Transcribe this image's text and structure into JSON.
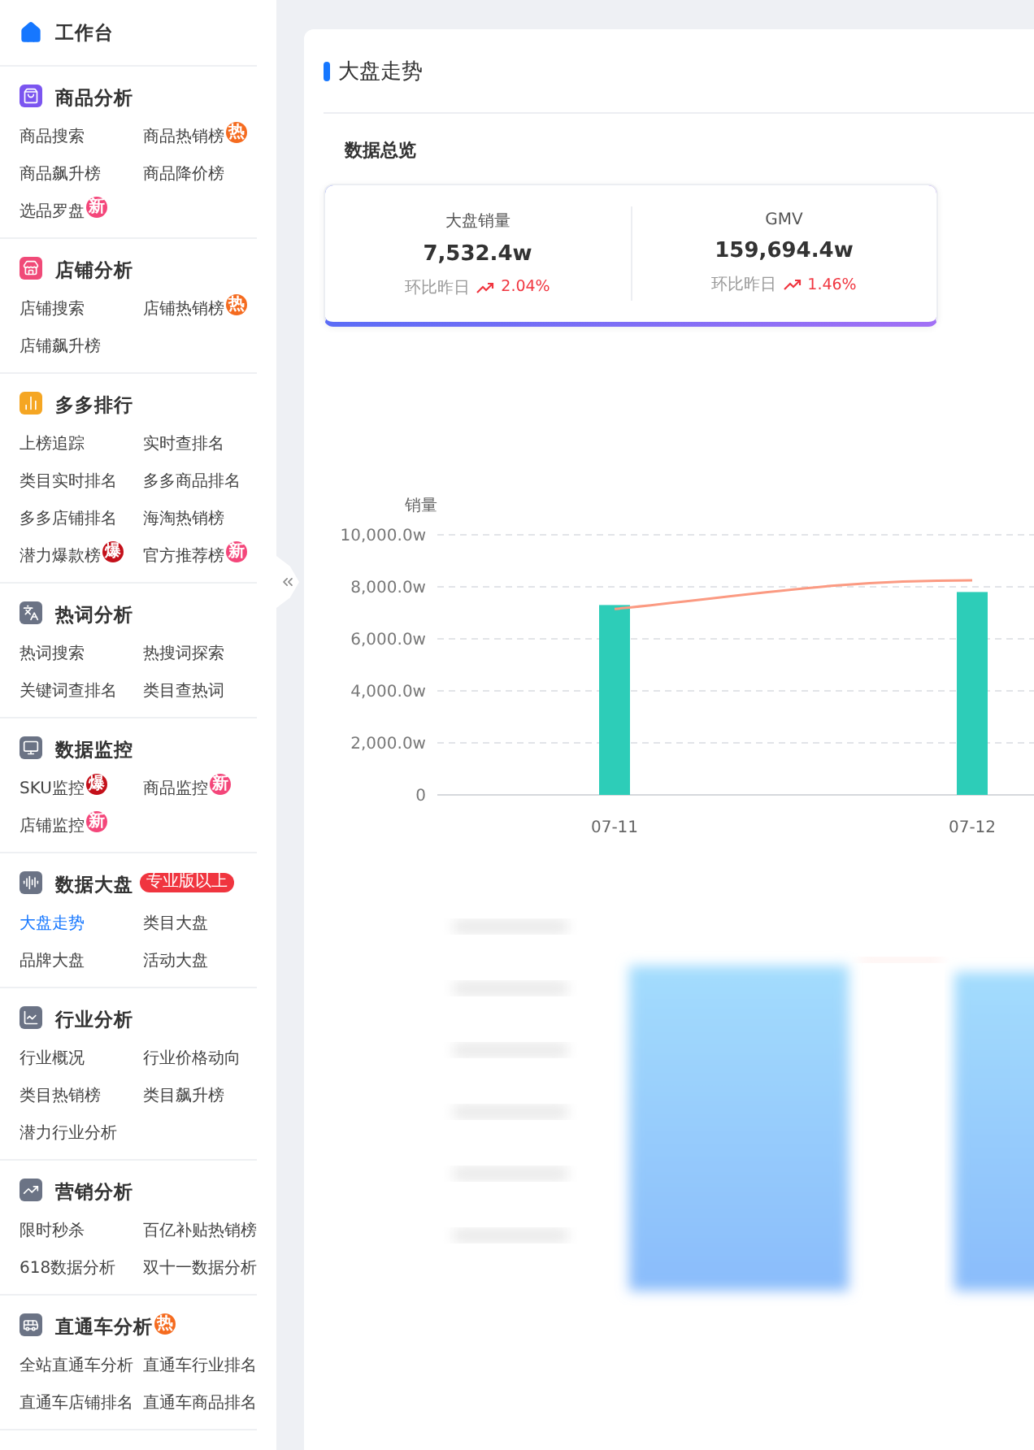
{
  "sidebar": {
    "home": {
      "label": "工作台"
    },
    "sections": [
      {
        "title": "商品分析",
        "items": [
          {
            "label": "商品搜索",
            "selected": false
          },
          {
            "label": "商品热销榜",
            "selected": false,
            "badge": {
              "kind": "hot",
              "text": "热"
            }
          },
          {
            "label": "商品飙升榜",
            "selected": false
          },
          {
            "label": "商品降价榜",
            "selected": false
          },
          {
            "label": "选品罗盘",
            "selected": false,
            "badge": {
              "kind": "new",
              "text": "新"
            }
          }
        ]
      },
      {
        "title": "店铺分析",
        "items": [
          {
            "label": "店铺搜索",
            "selected": false
          },
          {
            "label": "店铺热销榜",
            "selected": false,
            "badge": {
              "kind": "hot",
              "text": "热"
            }
          },
          {
            "label": "店铺飙升榜",
            "selected": false
          }
        ]
      },
      {
        "title": "多多排行",
        "items": [
          {
            "label": "上榜追踪",
            "selected": false
          },
          {
            "label": "实时查排名",
            "selected": false
          },
          {
            "label": "类目实时排名",
            "selected": false
          },
          {
            "label": "多多商品排名",
            "selected": false
          },
          {
            "label": "多多店铺排名",
            "selected": false
          },
          {
            "label": "海淘热销榜",
            "selected": false
          },
          {
            "label": "潜力爆款榜",
            "selected": false,
            "badge": {
              "kind": "boom",
              "text": "爆"
            }
          },
          {
            "label": "官方推荐榜",
            "selected": false,
            "badge": {
              "kind": "new",
              "text": "新"
            }
          }
        ]
      },
      {
        "title": "热词分析",
        "items": [
          {
            "label": "热词搜索",
            "selected": false
          },
          {
            "label": "热搜词探索",
            "selected": false
          },
          {
            "label": "关键词查排名",
            "selected": false
          },
          {
            "label": "类目查热词",
            "selected": false
          }
        ]
      },
      {
        "title": "数据监控",
        "items": [
          {
            "label": "SKU监控",
            "selected": false,
            "badge": {
              "kind": "boom",
              "text": "爆"
            }
          },
          {
            "label": "商品监控",
            "selected": false,
            "badge": {
              "kind": "new",
              "text": "新"
            }
          },
          {
            "label": "店铺监控",
            "selected": false,
            "badge": {
              "kind": "new",
              "text": "新"
            }
          }
        ]
      },
      {
        "title": "数据大盘",
        "badge": {
          "kind": "pro",
          "text": "专业版以上"
        },
        "items": [
          {
            "label": "大盘走势",
            "selected": true
          },
          {
            "label": "类目大盘",
            "selected": false
          },
          {
            "label": "品牌大盘",
            "selected": false
          },
          {
            "label": "活动大盘",
            "selected": false
          }
        ]
      },
      {
        "title": "行业分析",
        "items": [
          {
            "label": "行业概况",
            "selected": false
          },
          {
            "label": "行业价格动向",
            "selected": false
          },
          {
            "label": "类目热销榜",
            "selected": false
          },
          {
            "label": "类目飙升榜",
            "selected": false
          },
          {
            "label": "潜力行业分析",
            "selected": false
          }
        ]
      },
      {
        "title": "营销分析",
        "items": [
          {
            "label": "限时秒杀",
            "selected": false
          },
          {
            "label": "百亿补贴热销榜",
            "selected": false
          },
          {
            "label": "618数据分析",
            "selected": false
          },
          {
            "label": "双十一数据分析",
            "selected": false
          }
        ]
      },
      {
        "title": "直通车分析",
        "badge": {
          "kind": "hot",
          "text": "热"
        },
        "items": [
          {
            "label": "全站直通车分析",
            "selected": false
          },
          {
            "label": "直通车行业排名",
            "selected": false
          },
          {
            "label": "直通车店铺排名",
            "selected": false
          },
          {
            "label": "直通车商品排名",
            "selected": false
          }
        ]
      }
    ]
  },
  "main": {
    "title": "大盘走势",
    "overview": {
      "title": "数据总览",
      "stats": [
        {
          "label": "大盘销量",
          "value": "7,532.4w",
          "compare_label": "环比昨日",
          "change": "2.04%"
        },
        {
          "label": "GMV",
          "value": "159,694.4w",
          "compare_label": "环比昨日",
          "change": "1.46%"
        }
      ]
    },
    "chart_data": {
      "type": "bar",
      "ylabel": "销量",
      "categories": [
        "07-11",
        "07-12"
      ],
      "series": [
        {
          "type": "bar",
          "color": "#2dcdb8",
          "values": [
            7300,
            7800
          ]
        },
        {
          "type": "line",
          "color": "#fb9a82",
          "values": [
            7150,
            8250
          ]
        }
      ],
      "grid": true,
      "ylim": [
        0,
        10000
      ],
      "yticks": [
        {
          "value": 0,
          "label": "0"
        },
        {
          "value": 2000,
          "label": "2,000.0w"
        },
        {
          "value": 4000,
          "label": "4,000.0w"
        },
        {
          "value": 6000,
          "label": "6,000.0w"
        },
        {
          "value": 8000,
          "label": "8,000.0w"
        },
        {
          "value": 10000,
          "label": "10,000.0w"
        }
      ]
    }
  }
}
